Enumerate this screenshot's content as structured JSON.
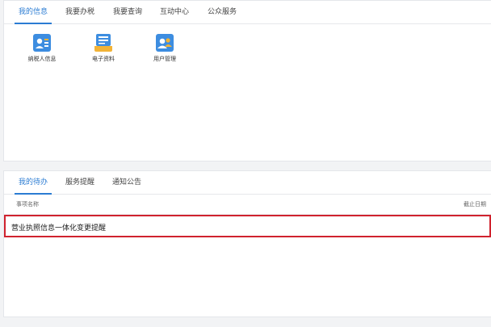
{
  "top_tabs": [
    {
      "label": "我的信息",
      "active": true
    },
    {
      "label": "我要办税",
      "active": false
    },
    {
      "label": "我要查询",
      "active": false
    },
    {
      "label": "互动中心",
      "active": false
    },
    {
      "label": "公众服务",
      "active": false
    }
  ],
  "shortcuts": [
    {
      "label": "纳税人信息",
      "icon": "taxpayer-card-icon"
    },
    {
      "label": "电子资料",
      "icon": "electronic-docs-icon"
    },
    {
      "label": "用户管理",
      "icon": "user-management-icon"
    }
  ],
  "bottom_tabs": [
    {
      "label": "我的待办",
      "active": true
    },
    {
      "label": "服务提醒",
      "active": false
    },
    {
      "label": "通知公告",
      "active": false
    }
  ],
  "todo_table": {
    "columns": [
      "事项名称",
      "截止日期"
    ],
    "rows": [
      {
        "title": "营业执照信息一体化变更提醒",
        "deadline": ""
      }
    ]
  },
  "colors": {
    "accent": "#2b7cd3",
    "highlight_border": "#d0222e",
    "background": "#f2f3f5"
  }
}
